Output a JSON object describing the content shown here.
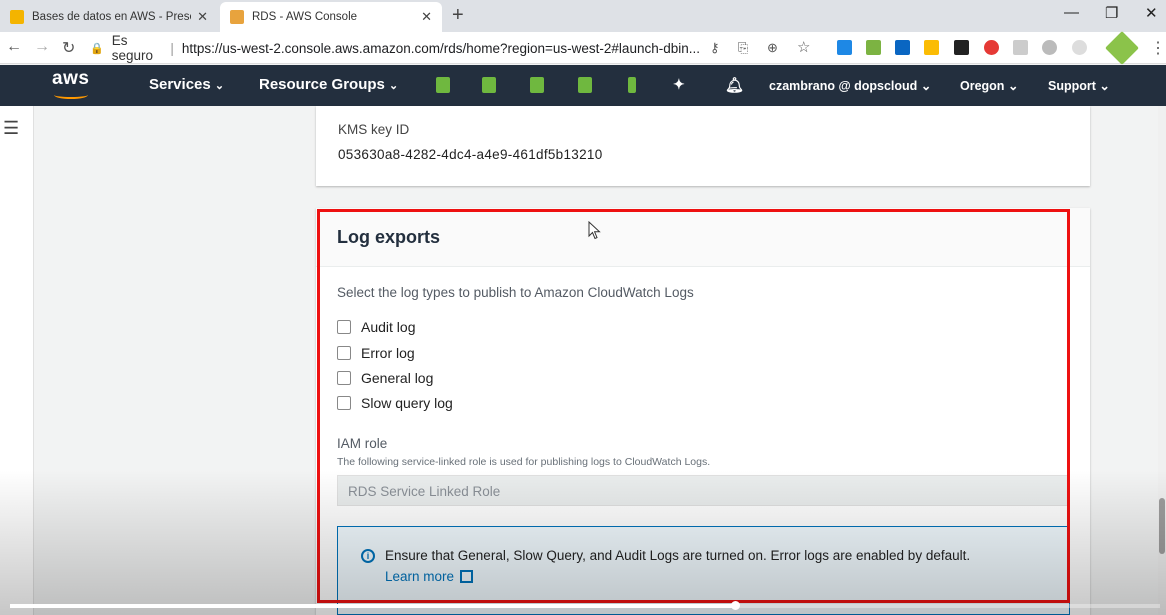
{
  "browser": {
    "tabs": [
      {
        "title": "Bases de datos en AWS - Present",
        "favicon_color": "#f4b400",
        "active": false
      },
      {
        "title": "RDS - AWS Console",
        "favicon_color": "#e8a33d",
        "active": true
      }
    ],
    "secure_label": "Es seguro",
    "url": "https://us-west-2.console.aws.amazon.com/rds/home?region=us-west-2#launch-dbin..."
  },
  "aws_nav": {
    "logo": "aws",
    "services": "Services",
    "resource_groups": "Resource Groups",
    "account": "czambrano @ dopscloud",
    "region": "Oregon",
    "support": "Support",
    "accent": "#ff9900",
    "bg": "#232f3e"
  },
  "kms": {
    "label": "KMS key ID",
    "value": "053630a8-4282-4dc4-a4e9-461df5b13210"
  },
  "log_exports": {
    "title": "Log exports",
    "description": "Select the log types to publish to Amazon CloudWatch Logs",
    "options": [
      {
        "label": "Audit log",
        "checked": false
      },
      {
        "label": "Error log",
        "checked": false
      },
      {
        "label": "General log",
        "checked": false
      },
      {
        "label": "Slow query log",
        "checked": false
      }
    ],
    "iam_label": "IAM role",
    "iam_description": "The following service-linked role is used for publishing logs to CloudWatch Logs.",
    "iam_value": "RDS Service Linked Role",
    "info_text": "Ensure that General, Slow Query, and Audit Logs are turned on. Error logs are enabled by default.",
    "learn_more": "Learn more"
  },
  "highlight_color": "#ee1111",
  "video_progress": 0.63
}
